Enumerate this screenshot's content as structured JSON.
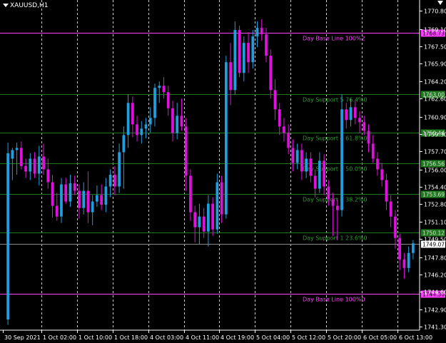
{
  "symbol": "XAUUSD,H1",
  "colors": {
    "background": "#000000",
    "bull": "#1e9fe0",
    "bear": "#e010e0",
    "support": "#1f7a1f",
    "support_text": "#2e9a2e",
    "base": "#ff40ff",
    "axis": "#ffffff",
    "grid": "#c8c8c8"
  },
  "icons": {
    "dropdown": "triangle-down-icon",
    "corner": "chevron-down-icon"
  },
  "chart_data": {
    "type": "candlestick",
    "y_range": [
      1741.0,
      1771.4
    ],
    "y_ticks": [
      1770.8,
      1769.1,
      1767.5,
      1765.9,
      1764.2,
      1762.6,
      1760.9,
      1759.3,
      1757.7,
      1756.0,
      1754.4,
      1752.8,
      1751.1,
      1749.5,
      1747.8,
      1746.2,
      1744.6,
      1742.9,
      1741.3
    ],
    "x_labels": [
      "30 Sep 2021",
      "1 Oct 02:00",
      "1 Oct 10:00",
      "1 Oct 18:00",
      "4 Oct 03:00",
      "4 Oct 11:00",
      "4 Oct 19:00",
      "5 Oct 04:00",
      "5 Oct 12:00",
      "5 Oct 20:00",
      "6 Oct 05:00",
      "6 Oct 13:00"
    ],
    "levels": [
      {
        "label": "Day Base Line 100%2",
        "price": "1768.73",
        "value": 1768.73,
        "kind": "base"
      },
      {
        "label": "Day Support 5 76.4%0",
        "price": "1763.00",
        "value": 1763.0,
        "kind": "support"
      },
      {
        "label": "Day Support 4 61.8%0",
        "price": "1759.44",
        "value": 1759.44,
        "kind": "support"
      },
      {
        "label": "Day Support 3 50.0%0",
        "price": "1756.56",
        "value": 1756.56,
        "kind": "support"
      },
      {
        "label": "Day Support 2 38.2%0",
        "price": "1753.69",
        "value": 1753.69,
        "kind": "support"
      },
      {
        "label": "Day Support 1 23.6%0",
        "price": "1750.12",
        "value": 1750.12,
        "kind": "support"
      },
      {
        "label": "Day Base Line 100%0",
        "price": "1744.36",
        "value": 1744.36,
        "kind": "base"
      }
    ],
    "current_price": {
      "price": "1749.07",
      "value": 1749.07
    },
    "candles": [
      {
        "o": 1742.0,
        "h": 1758.5,
        "l": 1741.5,
        "c": 1757.5
      },
      {
        "o": 1757.0,
        "h": 1758.0,
        "l": 1755.0,
        "c": 1757.8
      },
      {
        "o": 1757.8,
        "h": 1758.5,
        "l": 1755.5,
        "c": 1758.0
      },
      {
        "o": 1758.0,
        "h": 1758.6,
        "l": 1756.0,
        "c": 1756.3
      },
      {
        "o": 1756.3,
        "h": 1757.0,
        "l": 1755.2,
        "c": 1755.8
      },
      {
        "o": 1755.8,
        "h": 1757.5,
        "l": 1755.0,
        "c": 1757.0
      },
      {
        "o": 1757.0,
        "h": 1757.6,
        "l": 1755.2,
        "c": 1755.6
      },
      {
        "o": 1755.6,
        "h": 1758.2,
        "l": 1754.5,
        "c": 1757.2
      },
      {
        "o": 1757.2,
        "h": 1758.4,
        "l": 1755.5,
        "c": 1756.0
      },
      {
        "o": 1756.0,
        "h": 1757.0,
        "l": 1754.2,
        "c": 1754.8
      },
      {
        "o": 1754.8,
        "h": 1755.5,
        "l": 1751.5,
        "c": 1752.6
      },
      {
        "o": 1752.6,
        "h": 1753.8,
        "l": 1751.2,
        "c": 1751.6
      },
      {
        "o": 1751.6,
        "h": 1755.2,
        "l": 1751.0,
        "c": 1754.6
      },
      {
        "o": 1754.6,
        "h": 1755.2,
        "l": 1752.8,
        "c": 1753.0
      },
      {
        "o": 1753.0,
        "h": 1755.5,
        "l": 1752.5,
        "c": 1754.7
      },
      {
        "o": 1754.7,
        "h": 1755.4,
        "l": 1753.6,
        "c": 1754.0
      },
      {
        "o": 1754.0,
        "h": 1754.6,
        "l": 1751.4,
        "c": 1752.4
      },
      {
        "o": 1752.4,
        "h": 1754.8,
        "l": 1751.8,
        "c": 1754.0
      },
      {
        "o": 1754.0,
        "h": 1755.8,
        "l": 1751.0,
        "c": 1752.0
      },
      {
        "o": 1752.0,
        "h": 1753.6,
        "l": 1750.8,
        "c": 1753.0
      },
      {
        "o": 1753.0,
        "h": 1754.5,
        "l": 1752.5,
        "c": 1753.6
      },
      {
        "o": 1753.6,
        "h": 1754.6,
        "l": 1752.2,
        "c": 1752.7
      },
      {
        "o": 1752.7,
        "h": 1755.2,
        "l": 1752.0,
        "c": 1754.4
      },
      {
        "o": 1754.4,
        "h": 1756.0,
        "l": 1753.4,
        "c": 1755.5
      },
      {
        "o": 1755.5,
        "h": 1756.3,
        "l": 1753.6,
        "c": 1754.4
      },
      {
        "o": 1754.4,
        "h": 1758.4,
        "l": 1753.8,
        "c": 1757.6
      },
      {
        "o": 1757.6,
        "h": 1760.0,
        "l": 1754.2,
        "c": 1759.2
      },
      {
        "o": 1759.2,
        "h": 1763.0,
        "l": 1758.0,
        "c": 1762.2
      },
      {
        "o": 1762.2,
        "h": 1762.8,
        "l": 1759.0,
        "c": 1760.2
      },
      {
        "o": 1760.2,
        "h": 1761.0,
        "l": 1758.6,
        "c": 1759.2
      },
      {
        "o": 1759.2,
        "h": 1760.5,
        "l": 1758.4,
        "c": 1759.8
      },
      {
        "o": 1759.8,
        "h": 1760.8,
        "l": 1758.9,
        "c": 1760.2
      },
      {
        "o": 1760.2,
        "h": 1761.8,
        "l": 1759.4,
        "c": 1760.8
      },
      {
        "o": 1760.8,
        "h": 1764.0,
        "l": 1760.0,
        "c": 1763.6
      },
      {
        "o": 1763.6,
        "h": 1764.2,
        "l": 1762.2,
        "c": 1763.8
      },
      {
        "o": 1763.8,
        "h": 1764.6,
        "l": 1762.6,
        "c": 1763.2
      },
      {
        "o": 1763.2,
        "h": 1763.8,
        "l": 1761.0,
        "c": 1761.7
      },
      {
        "o": 1761.7,
        "h": 1762.4,
        "l": 1758.6,
        "c": 1759.4
      },
      {
        "o": 1759.4,
        "h": 1762.2,
        "l": 1758.8,
        "c": 1761.0
      },
      {
        "o": 1761.0,
        "h": 1762.6,
        "l": 1759.6,
        "c": 1760.0
      },
      {
        "o": 1760.0,
        "h": 1760.8,
        "l": 1754.0,
        "c": 1755.4
      },
      {
        "o": 1755.4,
        "h": 1756.0,
        "l": 1751.2,
        "c": 1752.0
      },
      {
        "o": 1752.0,
        "h": 1752.6,
        "l": 1749.2,
        "c": 1750.6
      },
      {
        "o": 1750.6,
        "h": 1752.8,
        "l": 1749.0,
        "c": 1751.6
      },
      {
        "o": 1751.6,
        "h": 1752.4,
        "l": 1749.6,
        "c": 1750.2
      },
      {
        "o": 1750.2,
        "h": 1753.6,
        "l": 1748.8,
        "c": 1752.8
      },
      {
        "o": 1752.8,
        "h": 1753.4,
        "l": 1749.8,
        "c": 1750.4
      },
      {
        "o": 1750.4,
        "h": 1755.6,
        "l": 1750.0,
        "c": 1754.8
      },
      {
        "o": 1754.8,
        "h": 1755.4,
        "l": 1751.0,
        "c": 1751.8
      },
      {
        "o": 1751.8,
        "h": 1766.6,
        "l": 1751.4,
        "c": 1766.0
      },
      {
        "o": 1766.0,
        "h": 1767.8,
        "l": 1762.0,
        "c": 1763.4
      },
      {
        "o": 1763.4,
        "h": 1769.8,
        "l": 1763.0,
        "c": 1769.0
      },
      {
        "o": 1769.0,
        "h": 1769.4,
        "l": 1764.6,
        "c": 1765.0
      },
      {
        "o": 1765.0,
        "h": 1768.4,
        "l": 1764.2,
        "c": 1767.8
      },
      {
        "o": 1767.8,
        "h": 1768.8,
        "l": 1765.0,
        "c": 1766.0
      },
      {
        "o": 1766.0,
        "h": 1769.0,
        "l": 1765.4,
        "c": 1768.4
      },
      {
        "o": 1768.4,
        "h": 1769.8,
        "l": 1767.4,
        "c": 1769.2
      },
      {
        "o": 1769.2,
        "h": 1770.0,
        "l": 1768.0,
        "c": 1768.6
      },
      {
        "o": 1768.6,
        "h": 1769.2,
        "l": 1766.0,
        "c": 1766.6
      },
      {
        "o": 1766.6,
        "h": 1767.2,
        "l": 1762.6,
        "c": 1763.4
      },
      {
        "o": 1763.4,
        "h": 1764.4,
        "l": 1760.6,
        "c": 1761.6
      },
      {
        "o": 1761.6,
        "h": 1762.2,
        "l": 1759.2,
        "c": 1760.0
      },
      {
        "o": 1760.0,
        "h": 1760.8,
        "l": 1758.6,
        "c": 1759.4
      },
      {
        "o": 1759.4,
        "h": 1760.2,
        "l": 1757.4,
        "c": 1758.0
      },
      {
        "o": 1758.0,
        "h": 1758.8,
        "l": 1755.8,
        "c": 1756.6
      },
      {
        "o": 1756.6,
        "h": 1758.4,
        "l": 1756.0,
        "c": 1757.8
      },
      {
        "o": 1757.8,
        "h": 1758.4,
        "l": 1755.0,
        "c": 1755.8
      },
      {
        "o": 1755.8,
        "h": 1757.6,
        "l": 1755.2,
        "c": 1757.0
      },
      {
        "o": 1757.0,
        "h": 1757.6,
        "l": 1754.8,
        "c": 1755.4
      },
      {
        "o": 1755.4,
        "h": 1756.0,
        "l": 1753.4,
        "c": 1754.2
      },
      {
        "o": 1754.2,
        "h": 1757.6,
        "l": 1753.8,
        "c": 1756.8
      },
      {
        "o": 1756.8,
        "h": 1757.4,
        "l": 1753.6,
        "c": 1754.4
      },
      {
        "o": 1754.4,
        "h": 1755.0,
        "l": 1752.6,
        "c": 1753.2
      },
      {
        "o": 1753.2,
        "h": 1753.8,
        "l": 1749.8,
        "c": 1752.6
      },
      {
        "o": 1752.6,
        "h": 1753.2,
        "l": 1749.4,
        "c": 1752.2
      },
      {
        "o": 1752.2,
        "h": 1763.0,
        "l": 1751.6,
        "c": 1761.6
      },
      {
        "o": 1761.6,
        "h": 1762.2,
        "l": 1759.8,
        "c": 1760.6
      },
      {
        "o": 1760.6,
        "h": 1762.6,
        "l": 1760.0,
        "c": 1761.8
      },
      {
        "o": 1761.8,
        "h": 1762.4,
        "l": 1760.2,
        "c": 1760.8
      },
      {
        "o": 1760.8,
        "h": 1761.4,
        "l": 1759.4,
        "c": 1760.4
      },
      {
        "o": 1760.4,
        "h": 1761.0,
        "l": 1759.2,
        "c": 1759.6
      },
      {
        "o": 1759.6,
        "h": 1760.2,
        "l": 1757.6,
        "c": 1758.4
      },
      {
        "o": 1758.4,
        "h": 1759.2,
        "l": 1756.6,
        "c": 1757.0
      },
      {
        "o": 1757.0,
        "h": 1757.6,
        "l": 1755.4,
        "c": 1756.0
      },
      {
        "o": 1756.0,
        "h": 1756.6,
        "l": 1754.4,
        "c": 1755.0
      },
      {
        "o": 1755.0,
        "h": 1755.6,
        "l": 1752.2,
        "c": 1753.0
      },
      {
        "o": 1753.0,
        "h": 1753.6,
        "l": 1750.6,
        "c": 1751.6
      },
      {
        "o": 1751.6,
        "h": 1752.2,
        "l": 1748.6,
        "c": 1749.6
      },
      {
        "o": 1749.6,
        "h": 1750.0,
        "l": 1746.6,
        "c": 1747.6
      },
      {
        "o": 1747.6,
        "h": 1748.2,
        "l": 1745.8,
        "c": 1746.8
      },
      {
        "o": 1746.8,
        "h": 1748.8,
        "l": 1746.4,
        "c": 1748.2
      },
      {
        "o": 1748.2,
        "h": 1749.4,
        "l": 1747.6,
        "c": 1749.1
      }
    ]
  }
}
